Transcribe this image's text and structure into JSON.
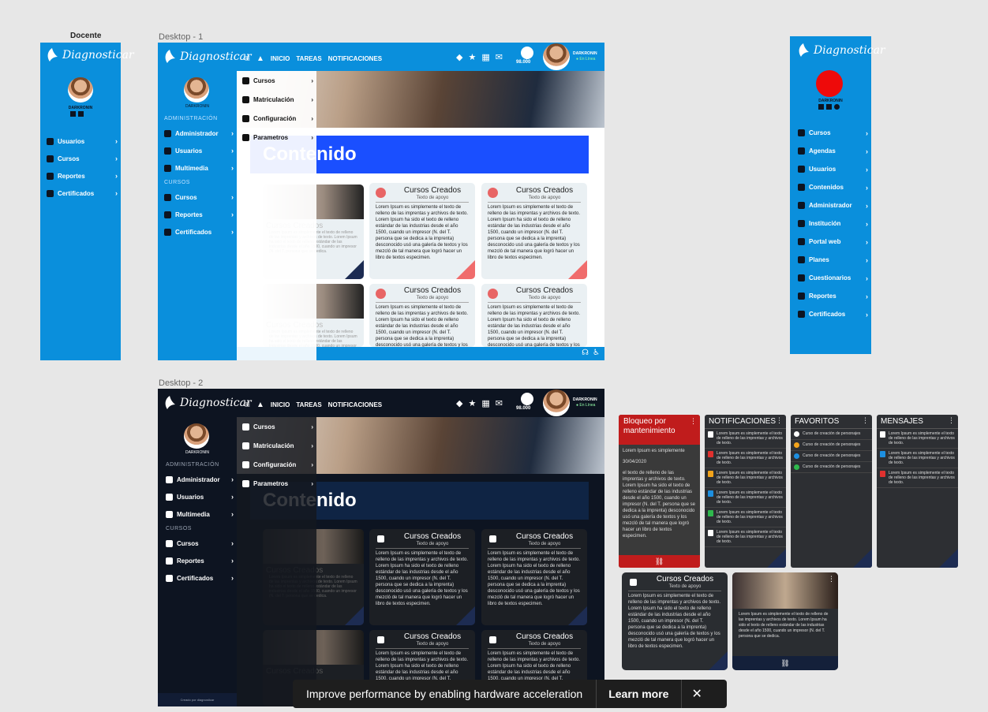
{
  "frames": {
    "docente_label": "Docente",
    "desktop1_label": "Desktop - 1",
    "desktop2_label": "Desktop - 2"
  },
  "brand": {
    "logo_text": "Diagnosticar"
  },
  "user": {
    "name": "DARKRONIN",
    "status": "En Línea",
    "points": "98.000"
  },
  "topnav": {
    "inicio": "INICIO",
    "tareas": "TAREAS",
    "notificaciones": "NOTIFICACIONES"
  },
  "docente_menu": [
    {
      "label": "Usuarios",
      "icon": "user-icon"
    },
    {
      "label": "Cursos",
      "icon": "music-icon"
    },
    {
      "label": "Reportes",
      "icon": "user-icon"
    },
    {
      "label": "Certificados",
      "icon": "certificate-icon"
    }
  ],
  "admin_section": "ADMINISTRACIÓN",
  "admin_menu": [
    {
      "label": "Administrador",
      "icon": "admin-icon"
    },
    {
      "label": "Usuarios",
      "icon": "user-icon"
    },
    {
      "label": "Multimedia",
      "icon": "media-icon"
    }
  ],
  "cursos_section": "CURSOS",
  "cursos_menu": [
    {
      "label": "Cursos",
      "icon": "music-icon"
    },
    {
      "label": "Reportes",
      "icon": "user-icon"
    },
    {
      "label": "Certificados",
      "icon": "certificate-icon"
    }
  ],
  "dropdown": [
    {
      "label": "Cursos",
      "icon": "music-icon"
    },
    {
      "label": "Matriculación",
      "icon": "calendar-icon"
    },
    {
      "label": "Configuración",
      "icon": "user-icon"
    },
    {
      "label": "Parametros",
      "icon": "monitor-icon"
    }
  ],
  "content_title": "Contenido",
  "card": {
    "title": "Cursos Creados",
    "subtitle": "Texto de apoyo",
    "body": "Lorem Ipsum es simplemente el texto de relleno de las imprentas y archivos de texto. Lorem Ipsum ha sido el texto de relleno estándar de las industrias desde el año 1500, cuando un impresor (N. del T. persona que se dedica a la imprenta) desconocido usó una galería de textos y los mezcló de tal manera que logró hacer un libro de textos especimen.",
    "short_body": "Lorem Ipsum es simplemente el texto de relleno de las imprentas y archivos de texto. Lorem Ipsum ha sido el texto de relleno estándar de las industrias desde el año 1500, cuando un impresor (N. del T. persona que se dedica."
  },
  "right_menu": [
    {
      "label": "Cursos",
      "icon": "music-icon"
    },
    {
      "label": "Agendas",
      "icon": "calendar-icon"
    },
    {
      "label": "Usuarios",
      "icon": "user-icon"
    },
    {
      "label": "Contenidos",
      "icon": "monitor-icon"
    },
    {
      "label": "Administrador",
      "icon": "admin-icon"
    },
    {
      "label": "Institución",
      "icon": "building-icon"
    },
    {
      "label": "Portal web",
      "icon": "user-icon"
    },
    {
      "label": "Planes",
      "icon": "media-icon"
    },
    {
      "label": "Cuestionarios",
      "icon": "monitor-icon"
    },
    {
      "label": "Reportes",
      "icon": "user-icon"
    },
    {
      "label": "Certificados",
      "icon": "certificate-icon"
    }
  ],
  "bloqueo": {
    "title": "Bloqueo por mantenimiento",
    "intro": "Lorem Ipsum es simplemente",
    "date": "30/04/2020",
    "body": "el texto de relleno de las imprentas y archivos de texto. Lorem Ipsum ha sido el texto de relleno estándar de las industrias desde el año 1500, cuando un impresor (N. del T. persona que se dedica a la imprenta) desconocido usó una galería de textos y los mezcló de tal manera que logró hacer un libro de textos especimen."
  },
  "notificaciones": {
    "title": "NOTIFICACIONES",
    "item_text": "Lorem Ipsum es simplemente el texto de relleno de las imprentas y archivos de texto.",
    "colors": [
      "#ffffff",
      "#e0312f",
      "#f2a31b",
      "#1d8fe0",
      "#2fb84d",
      "#ffffff"
    ]
  },
  "favoritos": {
    "title": "FAVORITOS",
    "items": [
      "Curso de creación de personajes",
      "Curso de creación de personajes",
      "Curso de creación de personajes",
      "Curso de creación de personajes"
    ],
    "colors": [
      "#ffffff",
      "#f2a31b",
      "#1d8fe0",
      "#2fb84d"
    ]
  },
  "mensajes": {
    "title": "MENSAJES",
    "item_text": "Lorem Ipsum es simplemente el texto de relleno de las imprentas y archivos de texto.",
    "colors": [
      "#ffffff",
      "#1d8fe0",
      "#e0312f"
    ]
  },
  "footer_text": "Creado por diagnosticar",
  "toast": {
    "message": "Improve performance by enabling hardware acceleration",
    "action": "Learn more"
  }
}
